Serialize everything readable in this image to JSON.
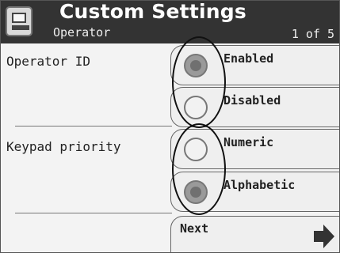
{
  "header": {
    "title": "Custom Settings",
    "subtitle": "Operator",
    "pager": "1 of 5",
    "icon": "device-icon"
  },
  "operator_id": {
    "label": "Operator ID",
    "options": [
      {
        "label": "Enabled",
        "selected": true
      },
      {
        "label": "Disabled",
        "selected": false
      }
    ]
  },
  "keypad_priority": {
    "label": "Keypad priority",
    "options": [
      {
        "label": "Numeric",
        "selected": false
      },
      {
        "label": "Alphabetic",
        "selected": true
      }
    ]
  },
  "next": {
    "label": "Next",
    "icon": "arrow-right-icon"
  },
  "colors": {
    "header_bg": "#333333",
    "panel_bg": "#f3f3f3",
    "selected_radio": "#707070"
  }
}
